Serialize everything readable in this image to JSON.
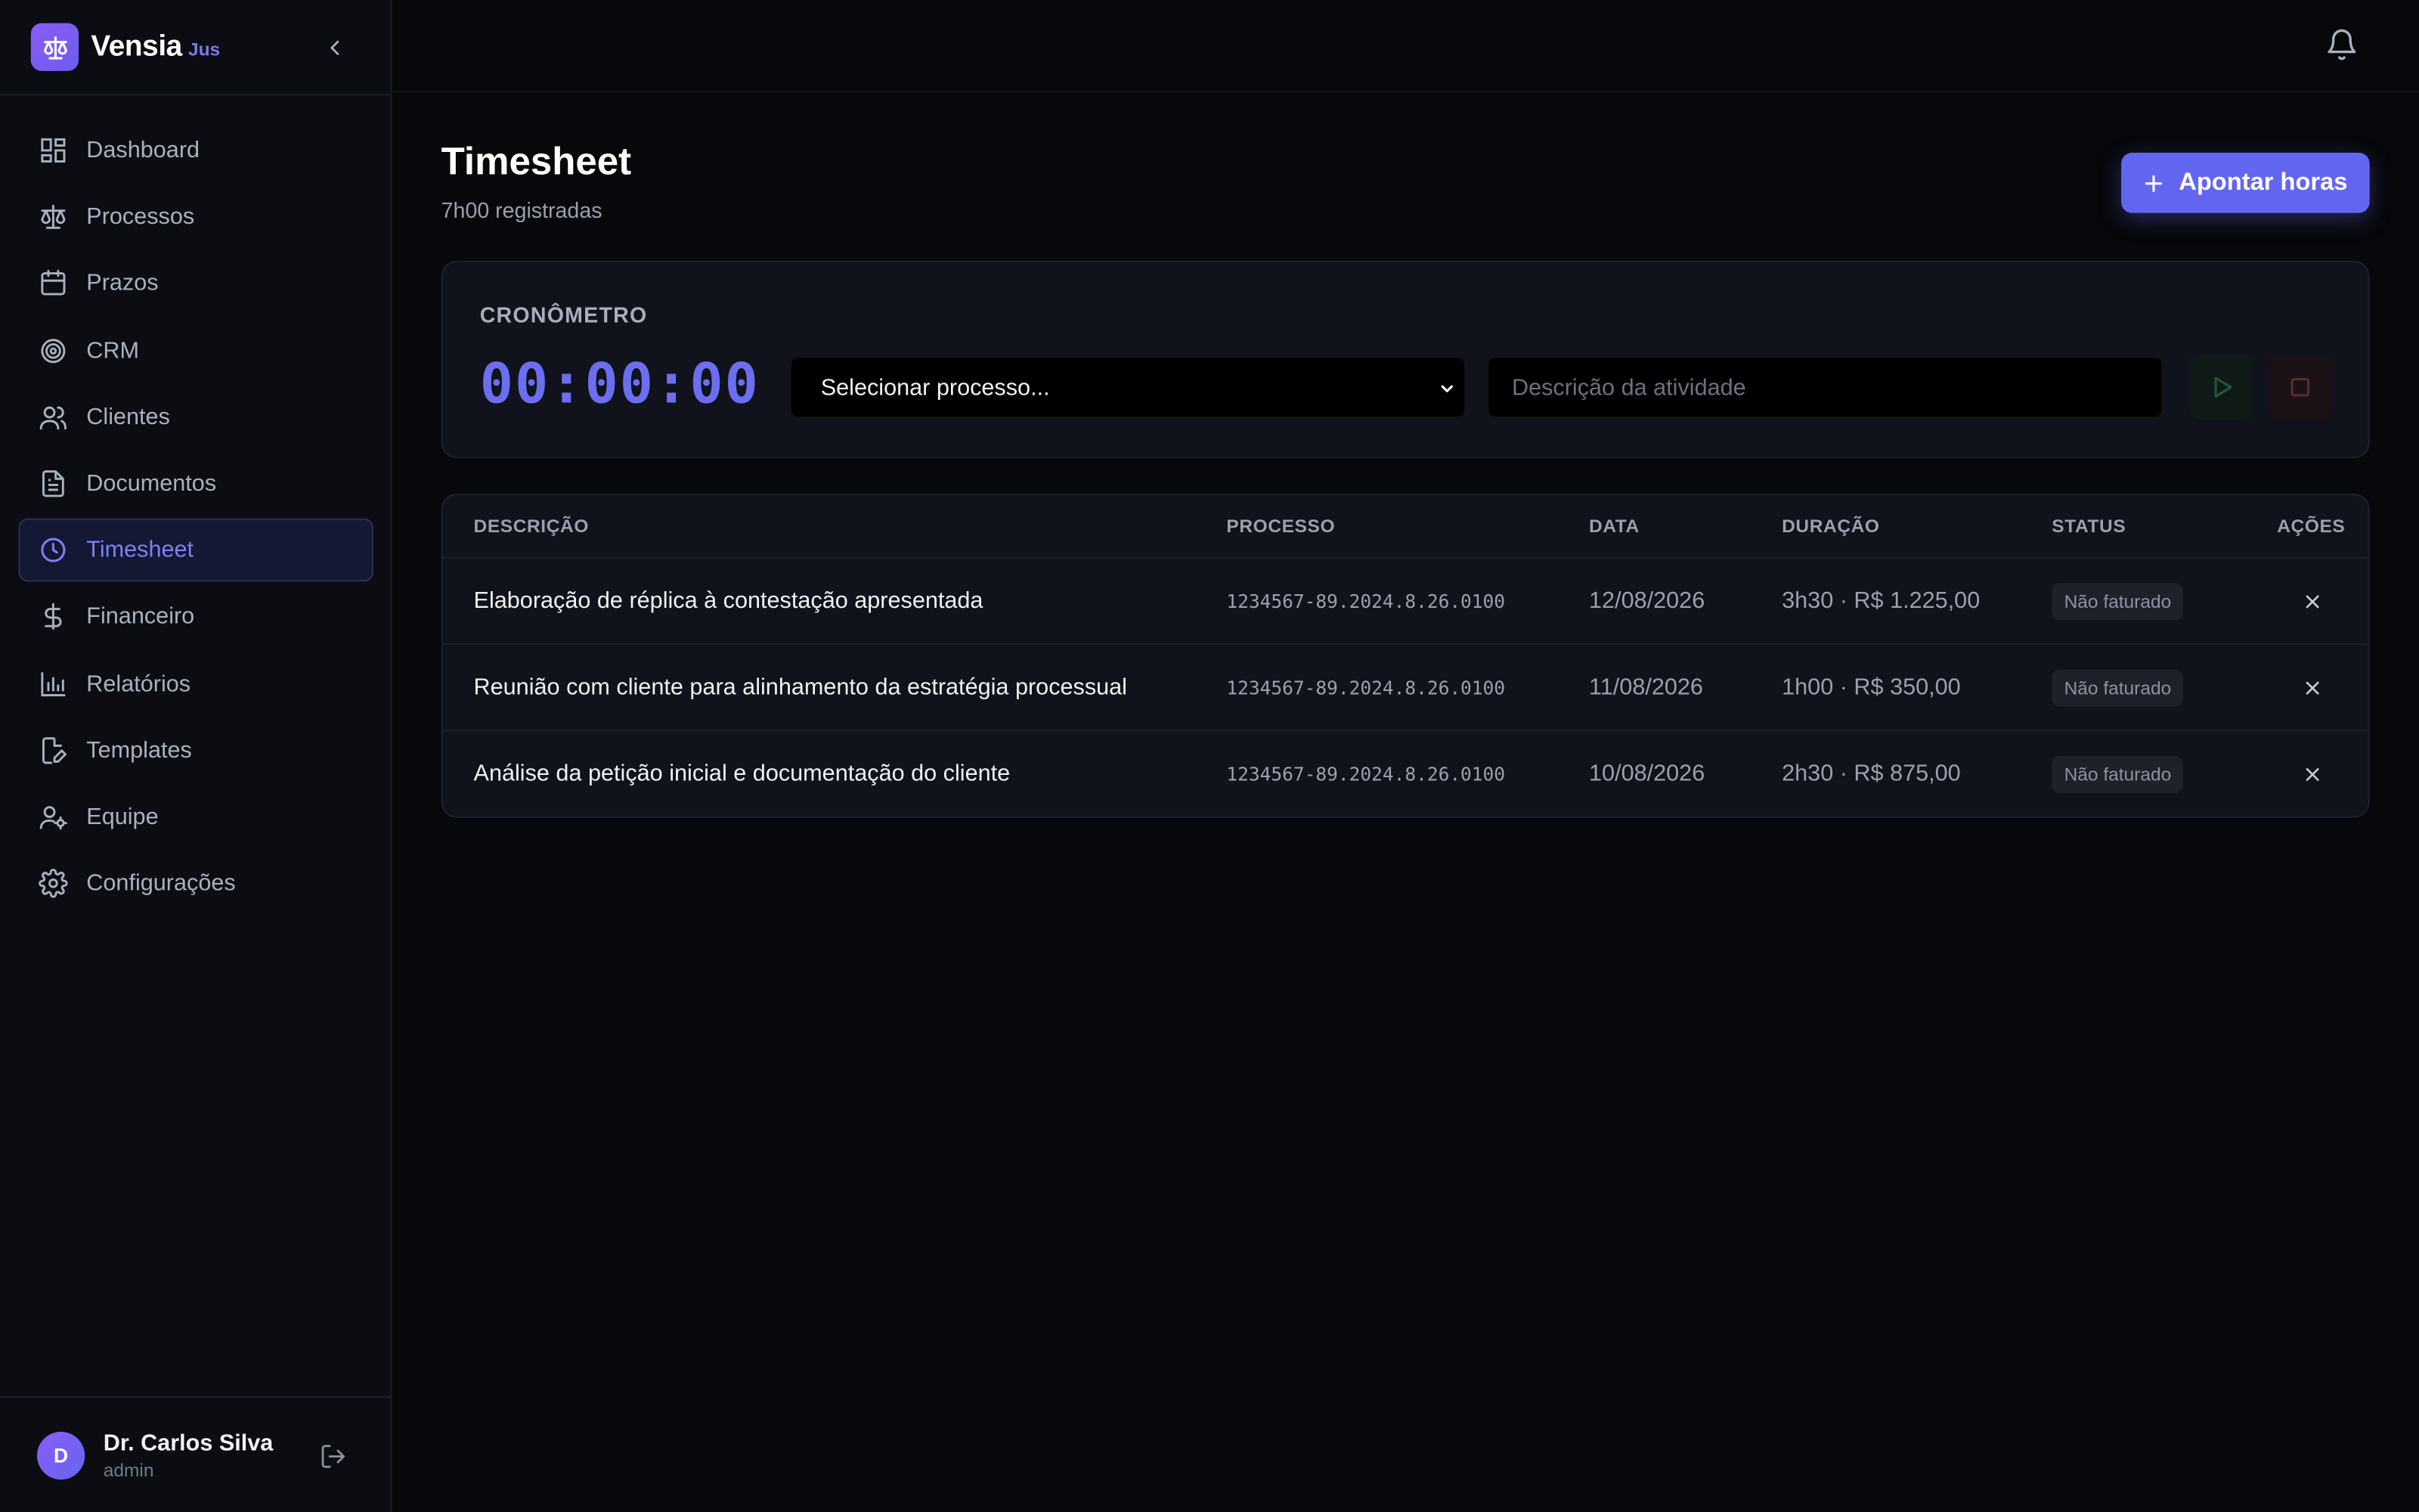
{
  "brand": {
    "name": "Vensia",
    "tag": "Jus"
  },
  "sidebar": {
    "items": [
      {
        "label": "Dashboard",
        "icon": "layout-dashboard-icon"
      },
      {
        "label": "Processos",
        "icon": "scale-icon"
      },
      {
        "label": "Prazos",
        "icon": "calendar-icon"
      },
      {
        "label": "CRM",
        "icon": "target-icon"
      },
      {
        "label": "Clientes",
        "icon": "users-icon"
      },
      {
        "label": "Documentos",
        "icon": "file-text-icon"
      },
      {
        "label": "Timesheet",
        "icon": "clock-icon",
        "active": true
      },
      {
        "label": "Financeiro",
        "icon": "dollar-icon"
      },
      {
        "label": "Relatórios",
        "icon": "bar-chart-icon"
      },
      {
        "label": "Templates",
        "icon": "file-edit-icon"
      },
      {
        "label": "Equipe",
        "icon": "user-cog-icon"
      },
      {
        "label": "Configurações",
        "icon": "gear-icon"
      }
    ]
  },
  "user": {
    "initial": "D",
    "name": "Dr. Carlos Silva",
    "role": "admin"
  },
  "page": {
    "title": "Timesheet",
    "subtitle": "7h00 registradas",
    "primary_action": "Apontar horas"
  },
  "timer": {
    "label": "CRONÔMETRO",
    "display": "00:00:00",
    "process_select": {
      "value": "Selecionar processo..."
    },
    "description_input": {
      "placeholder": "Descrição da atividade",
      "value": ""
    }
  },
  "table": {
    "headers": {
      "description": "DESCRIÇÃO",
      "process": "PROCESSO",
      "date": "DATA",
      "duration": "DURAÇÃO",
      "status": "STATUS",
      "actions": "AÇÕES"
    },
    "rows": [
      {
        "description": "Elaboração de réplica à contestação apresentada",
        "process": "1234567-89.2024.8.26.0100",
        "date": "12/08/2026",
        "duration": "3h30 · R$ 1.225,00",
        "status": "Não faturado"
      },
      {
        "description": "Reunião com cliente para alinhamento da estratégia processual",
        "process": "1234567-89.2024.8.26.0100",
        "date": "11/08/2026",
        "duration": "1h00 · R$ 350,00",
        "status": "Não faturado"
      },
      {
        "description": "Análise da petição inicial e documentação do cliente",
        "process": "1234567-89.2024.8.26.0100",
        "date": "10/08/2026",
        "duration": "2h30 · R$ 875,00",
        "status": "Não faturado"
      }
    ]
  },
  "colors": {
    "accent": "#6366f1",
    "background": "#07080b",
    "sidebar": "#0b0d13",
    "card": "#10131b"
  }
}
